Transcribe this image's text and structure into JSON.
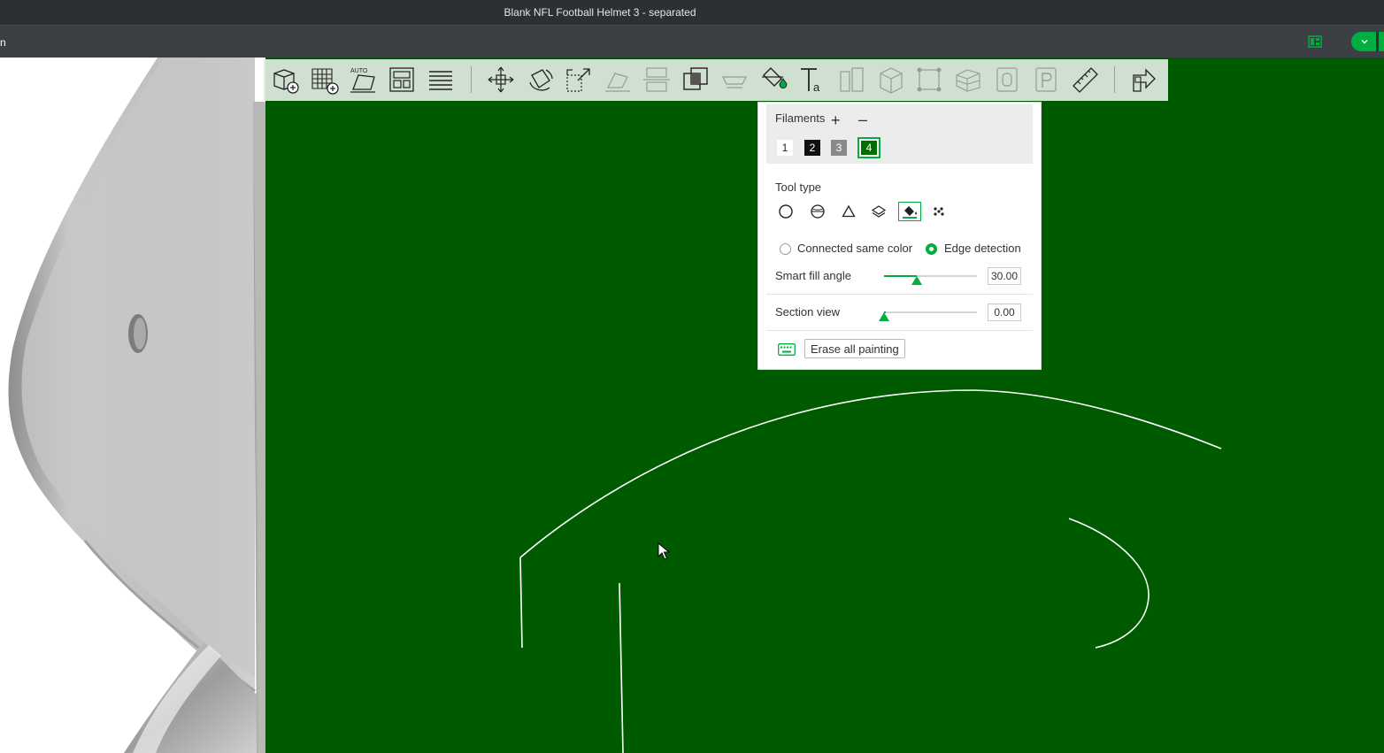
{
  "window": {
    "title": "Blank NFL Football Helmet 3 - separated",
    "left_glyph": "n"
  },
  "colors": {
    "accent": "#00ae42",
    "paint_color": "#005b00",
    "model_gray": "#c4c4c4"
  },
  "toolbar": {
    "tools": [
      {
        "name": "add-object-icon",
        "enabled": true
      },
      {
        "name": "add-plate-icon",
        "enabled": true
      },
      {
        "name": "auto-orient-icon",
        "enabled": true
      },
      {
        "name": "arrange-icon",
        "enabled": true
      },
      {
        "name": "split-plates-icon",
        "enabled": true
      },
      {
        "name": "move-icon",
        "enabled": true
      },
      {
        "name": "rotate-icon",
        "enabled": true
      },
      {
        "name": "scale-icon",
        "enabled": true
      },
      {
        "name": "lay-on-face-icon",
        "enabled": false
      },
      {
        "name": "cut-icon",
        "enabled": false
      },
      {
        "name": "boolean-icon",
        "enabled": true
      },
      {
        "name": "support-paint-icon",
        "enabled": false
      },
      {
        "name": "color-paint-icon",
        "enabled": true
      },
      {
        "name": "text-icon",
        "enabled": true
      },
      {
        "name": "assembly-icon",
        "enabled": false
      },
      {
        "name": "fuzzy-skin-icon",
        "enabled": false
      },
      {
        "name": "seam-paint-icon",
        "enabled": false
      },
      {
        "name": "mesh-repair-icon",
        "enabled": false
      },
      {
        "name": "variable-layer-icon",
        "enabled": false
      },
      {
        "name": "emboss-icon",
        "enabled": false
      },
      {
        "name": "measure-icon",
        "enabled": true
      },
      {
        "name": "assemble-view-icon",
        "enabled": true
      }
    ],
    "auto_badge": "AUTO"
  },
  "paint_panel": {
    "filaments_label": "Filaments",
    "add_symbol": "+",
    "remove_symbol": "–",
    "filaments": [
      {
        "label": "1",
        "bg": "#ffffff",
        "fg": "#222222",
        "selected": false
      },
      {
        "label": "2",
        "bg": "#111111",
        "fg": "#ffffff",
        "selected": false
      },
      {
        "label": "3",
        "bg": "#8a8a8a",
        "fg": "#ffffff",
        "selected": false
      },
      {
        "label": "4",
        "bg": "#006e00",
        "fg": "#ffffff",
        "selected": true
      }
    ],
    "tool_type_label": "Tool type",
    "tool_types": [
      "circle-brush-icon",
      "sphere-brush-icon",
      "triangle-brush-icon",
      "height-range-icon",
      "fill-bucket-icon",
      "gap-fill-icon"
    ],
    "active_tool_type": "fill-bucket-icon",
    "fill_mode": {
      "option_connected": "Connected same color",
      "option_edge": "Edge detection",
      "selected": "Edge detection"
    },
    "smart_fill_angle": {
      "label": "Smart fill angle",
      "value": "30.00",
      "fraction": 0.35
    },
    "section_view": {
      "label": "Section view",
      "value": "0.00",
      "fraction": 0.0
    },
    "erase_button": "Erase all painting",
    "keyboard_icon": "keyboard-icon"
  }
}
